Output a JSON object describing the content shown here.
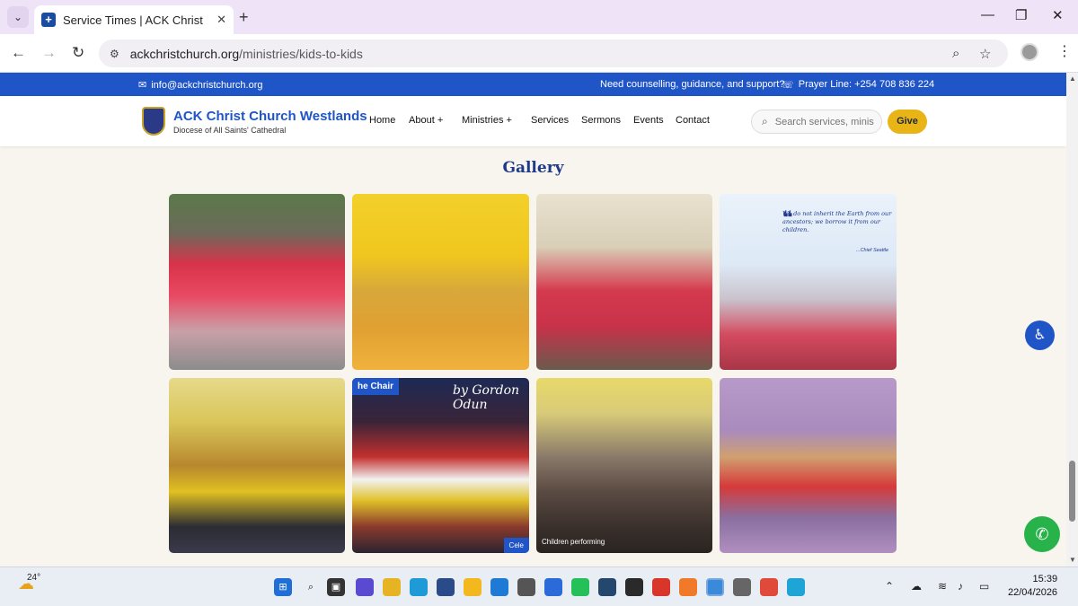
{
  "browser": {
    "tab_title": "Service Times | ACK Christ Chur",
    "url_host": "ackchristchurch.org",
    "url_path": "/ministries/kids-to-kids"
  },
  "topbar": {
    "email": "info@ackchristchurch.org",
    "help_text": "Need counselling, guidance, and support?",
    "prayer_line": "Prayer Line: +254 708 836 224"
  },
  "header": {
    "brand_name": "ACK Christ Church Westlands",
    "brand_sub": "Diocese of All Saints' Cathedral",
    "nav": {
      "home": "Home",
      "about": "About",
      "ministries": "Ministries",
      "services": "Services",
      "sermons": "Sermons",
      "events": "Events",
      "contact": "Contact"
    },
    "search_placeholder": "Search services, ministries",
    "give_label": "Give"
  },
  "gallery": {
    "title": "Gallery",
    "photo3_quote": "We do not inherit the Earth from our ancestors; we borrow it from our children.",
    "photo3_author": "...Chief Seattle",
    "photo5_tag": "he Chair",
    "photo5_signature": "by Gordon Odun",
    "photo5_corner": "Cele",
    "photo6_caption": "Children performing"
  },
  "taskbar": {
    "temperature": "24°",
    "time": "15:39",
    "date": "22/04/2026"
  },
  "colors": {
    "brand_blue": "#1f55c7",
    "give_yellow": "#e8b416",
    "whatsapp_green": "#27b24a"
  }
}
